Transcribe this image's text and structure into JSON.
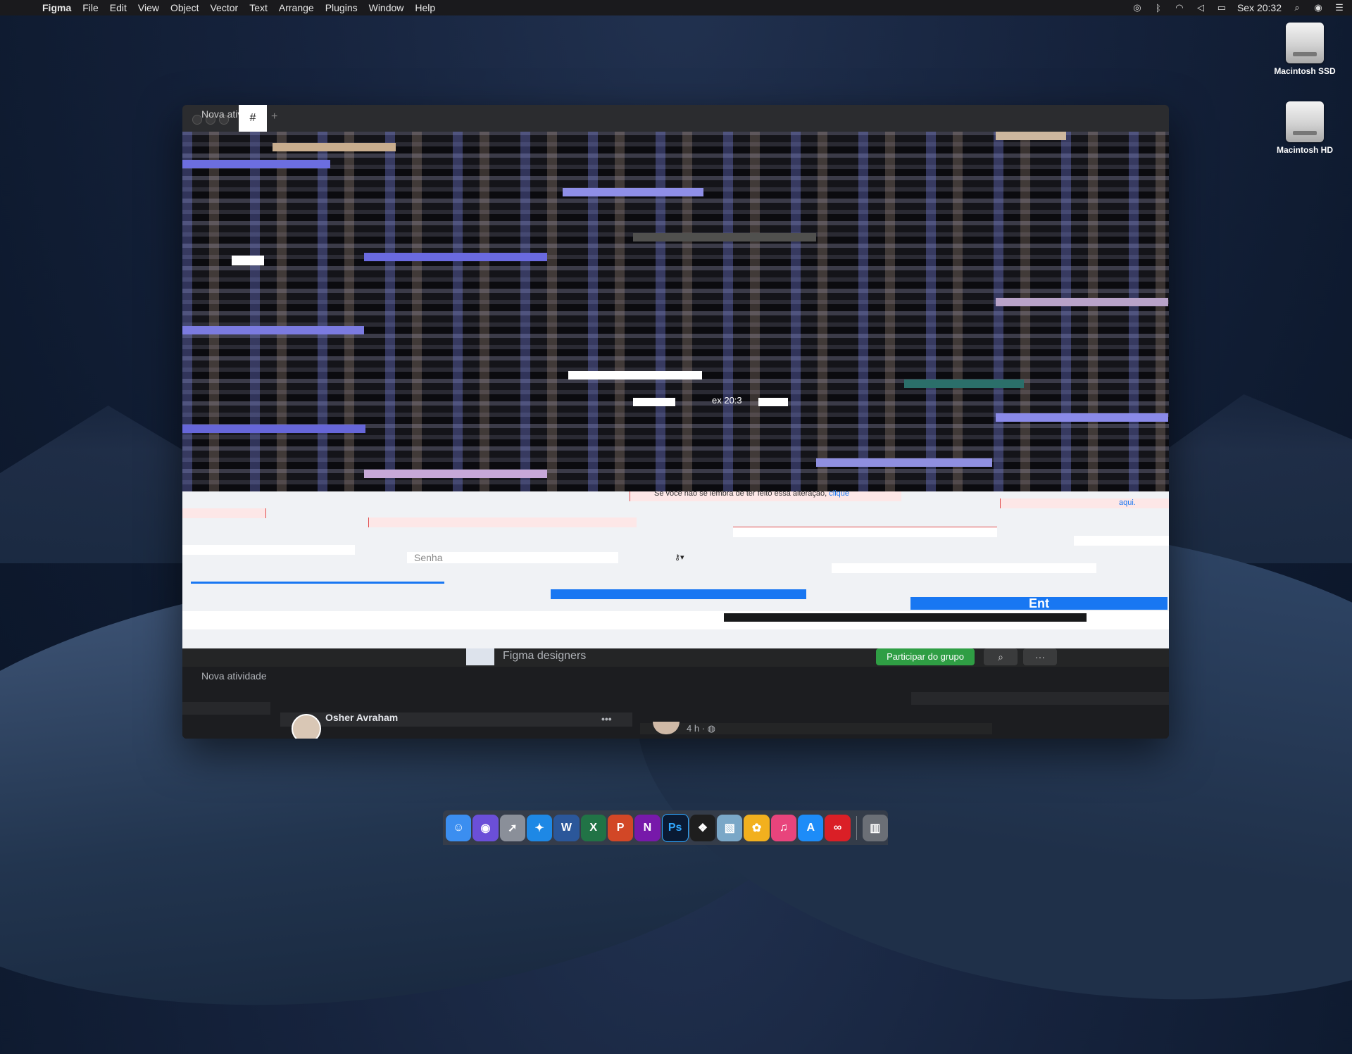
{
  "menubar": {
    "app_name": "Figma",
    "items": [
      "File",
      "Edit",
      "View",
      "Object",
      "Vector",
      "Text",
      "Arrange",
      "Plugins",
      "Window",
      "Help"
    ],
    "clock": "Sex 20:32"
  },
  "desktop": {
    "drives": [
      "Macintosh SSD",
      "Macintosh HD"
    ]
  },
  "window": {
    "tab_title": "Nova atividade",
    "glitch_clock_fragment": "ex 20:3",
    "form": {
      "warning_text": "Se você não se lembra de ter feito essa alteração,",
      "warning_link": "clique",
      "aqui_link": "aqui.",
      "password_placeholder": "Senha",
      "login_button": "Ent"
    },
    "group_bar": {
      "title": "Figma designers",
      "join_button": "Participar do grupo"
    },
    "feed": {
      "section_title": "Nova atividade",
      "post_author": "Osher Avraham",
      "post_time": "4 h · ",
      "more_label": "•••"
    }
  },
  "dock": {
    "apps": [
      {
        "name": "Finder",
        "color": "#3b8ef0",
        "glyph": "☺"
      },
      {
        "name": "Siri",
        "color": "#6b4fd8",
        "glyph": "◉"
      },
      {
        "name": "Launchpad",
        "color": "#8a8f99",
        "glyph": "➚"
      },
      {
        "name": "Safari",
        "color": "#1e88e5",
        "glyph": "✦"
      },
      {
        "name": "Word",
        "color": "#2b579a",
        "glyph": "W"
      },
      {
        "name": "Excel",
        "color": "#217346",
        "glyph": "X"
      },
      {
        "name": "PowerPoint",
        "color": "#d24726",
        "glyph": "P"
      },
      {
        "name": "OneNote",
        "color": "#7719aa",
        "glyph": "N"
      },
      {
        "name": "Photoshop",
        "color": "#0a1a33",
        "glyph": "Ps"
      },
      {
        "name": "Figma",
        "color": "#1e1e1e",
        "glyph": "❖"
      },
      {
        "name": "Preview",
        "color": "#7aa7c7",
        "glyph": "▧"
      },
      {
        "name": "Photos",
        "color": "#f2b01e",
        "glyph": "✿"
      },
      {
        "name": "iTunes",
        "color": "#e8447c",
        "glyph": "♫"
      },
      {
        "name": "App Store",
        "color": "#1d8cf8",
        "glyph": "A"
      },
      {
        "name": "Creative Cloud",
        "color": "#da1f26",
        "glyph": "∞"
      }
    ],
    "trash": {
      "name": "Trash",
      "color": "#6b6f76",
      "glyph": "🗑"
    }
  }
}
